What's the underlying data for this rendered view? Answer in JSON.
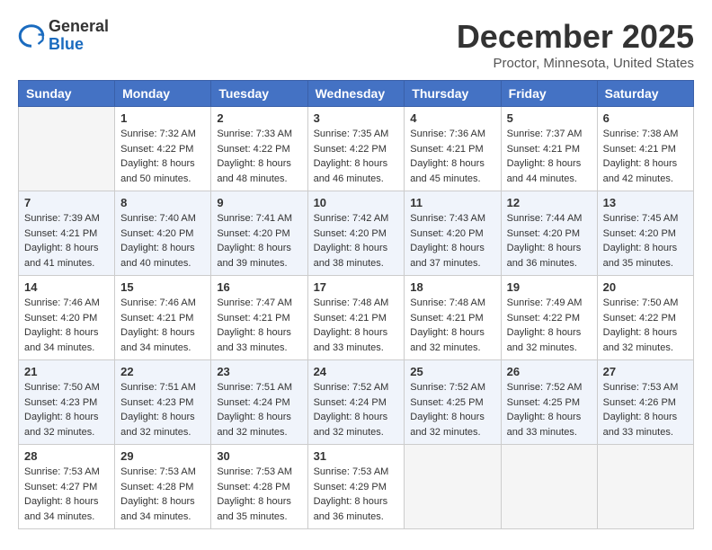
{
  "header": {
    "logo": {
      "general": "General",
      "blue": "Blue"
    },
    "title": "December 2025",
    "subtitle": "Proctor, Minnesota, United States"
  },
  "calendar": {
    "days_of_week": [
      "Sunday",
      "Monday",
      "Tuesday",
      "Wednesday",
      "Thursday",
      "Friday",
      "Saturday"
    ],
    "weeks": [
      [
        {
          "day": "",
          "empty": true,
          "info": ""
        },
        {
          "day": "1",
          "info": "Sunrise: 7:32 AM\nSunset: 4:22 PM\nDaylight: 8 hours\nand 50 minutes."
        },
        {
          "day": "2",
          "info": "Sunrise: 7:33 AM\nSunset: 4:22 PM\nDaylight: 8 hours\nand 48 minutes."
        },
        {
          "day": "3",
          "info": "Sunrise: 7:35 AM\nSunset: 4:22 PM\nDaylight: 8 hours\nand 46 minutes."
        },
        {
          "day": "4",
          "info": "Sunrise: 7:36 AM\nSunset: 4:21 PM\nDaylight: 8 hours\nand 45 minutes."
        },
        {
          "day": "5",
          "info": "Sunrise: 7:37 AM\nSunset: 4:21 PM\nDaylight: 8 hours\nand 44 minutes."
        },
        {
          "day": "6",
          "info": "Sunrise: 7:38 AM\nSunset: 4:21 PM\nDaylight: 8 hours\nand 42 minutes."
        }
      ],
      [
        {
          "day": "7",
          "info": "Sunrise: 7:39 AM\nSunset: 4:21 PM\nDaylight: 8 hours\nand 41 minutes."
        },
        {
          "day": "8",
          "info": "Sunrise: 7:40 AM\nSunset: 4:20 PM\nDaylight: 8 hours\nand 40 minutes."
        },
        {
          "day": "9",
          "info": "Sunrise: 7:41 AM\nSunset: 4:20 PM\nDaylight: 8 hours\nand 39 minutes."
        },
        {
          "day": "10",
          "info": "Sunrise: 7:42 AM\nSunset: 4:20 PM\nDaylight: 8 hours\nand 38 minutes."
        },
        {
          "day": "11",
          "info": "Sunrise: 7:43 AM\nSunset: 4:20 PM\nDaylight: 8 hours\nand 37 minutes."
        },
        {
          "day": "12",
          "info": "Sunrise: 7:44 AM\nSunset: 4:20 PM\nDaylight: 8 hours\nand 36 minutes."
        },
        {
          "day": "13",
          "info": "Sunrise: 7:45 AM\nSunset: 4:20 PM\nDaylight: 8 hours\nand 35 minutes."
        }
      ],
      [
        {
          "day": "14",
          "info": "Sunrise: 7:46 AM\nSunset: 4:20 PM\nDaylight: 8 hours\nand 34 minutes."
        },
        {
          "day": "15",
          "info": "Sunrise: 7:46 AM\nSunset: 4:21 PM\nDaylight: 8 hours\nand 34 minutes."
        },
        {
          "day": "16",
          "info": "Sunrise: 7:47 AM\nSunset: 4:21 PM\nDaylight: 8 hours\nand 33 minutes."
        },
        {
          "day": "17",
          "info": "Sunrise: 7:48 AM\nSunset: 4:21 PM\nDaylight: 8 hours\nand 33 minutes."
        },
        {
          "day": "18",
          "info": "Sunrise: 7:48 AM\nSunset: 4:21 PM\nDaylight: 8 hours\nand 32 minutes."
        },
        {
          "day": "19",
          "info": "Sunrise: 7:49 AM\nSunset: 4:22 PM\nDaylight: 8 hours\nand 32 minutes."
        },
        {
          "day": "20",
          "info": "Sunrise: 7:50 AM\nSunset: 4:22 PM\nDaylight: 8 hours\nand 32 minutes."
        }
      ],
      [
        {
          "day": "21",
          "info": "Sunrise: 7:50 AM\nSunset: 4:23 PM\nDaylight: 8 hours\nand 32 minutes."
        },
        {
          "day": "22",
          "info": "Sunrise: 7:51 AM\nSunset: 4:23 PM\nDaylight: 8 hours\nand 32 minutes."
        },
        {
          "day": "23",
          "info": "Sunrise: 7:51 AM\nSunset: 4:24 PM\nDaylight: 8 hours\nand 32 minutes."
        },
        {
          "day": "24",
          "info": "Sunrise: 7:52 AM\nSunset: 4:24 PM\nDaylight: 8 hours\nand 32 minutes."
        },
        {
          "day": "25",
          "info": "Sunrise: 7:52 AM\nSunset: 4:25 PM\nDaylight: 8 hours\nand 32 minutes."
        },
        {
          "day": "26",
          "info": "Sunrise: 7:52 AM\nSunset: 4:25 PM\nDaylight: 8 hours\nand 33 minutes."
        },
        {
          "day": "27",
          "info": "Sunrise: 7:53 AM\nSunset: 4:26 PM\nDaylight: 8 hours\nand 33 minutes."
        }
      ],
      [
        {
          "day": "28",
          "info": "Sunrise: 7:53 AM\nSunset: 4:27 PM\nDaylight: 8 hours\nand 34 minutes."
        },
        {
          "day": "29",
          "info": "Sunrise: 7:53 AM\nSunset: 4:28 PM\nDaylight: 8 hours\nand 34 minutes."
        },
        {
          "day": "30",
          "info": "Sunrise: 7:53 AM\nSunset: 4:28 PM\nDaylight: 8 hours\nand 35 minutes."
        },
        {
          "day": "31",
          "info": "Sunrise: 7:53 AM\nSunset: 4:29 PM\nDaylight: 8 hours\nand 36 minutes."
        },
        {
          "day": "",
          "empty": true,
          "info": ""
        },
        {
          "day": "",
          "empty": true,
          "info": ""
        },
        {
          "day": "",
          "empty": true,
          "info": ""
        }
      ]
    ]
  }
}
